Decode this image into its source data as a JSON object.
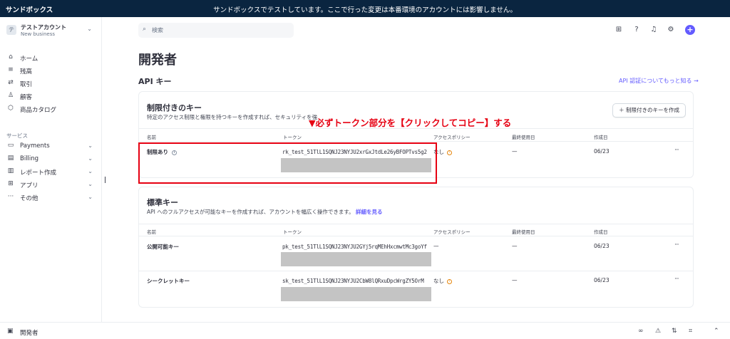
{
  "banner": {
    "brand": "サンドボックス",
    "message": "サンドボックスでテストしています。ここで行った変更は本番環境のアカウントには影響しません。"
  },
  "account": {
    "logo_letter": "テ",
    "name": "テストアカウント",
    "subtitle": "New business"
  },
  "sidebar": {
    "items": [
      {
        "icon": "home-icon",
        "label": "ホーム"
      },
      {
        "icon": "balance-icon",
        "label": "残高"
      },
      {
        "icon": "transactions-icon",
        "label": "取引"
      },
      {
        "icon": "customers-icon",
        "label": "顧客"
      },
      {
        "icon": "product-catalog-icon",
        "label": "商品カタログ"
      }
    ],
    "section_label": "サービス",
    "services": [
      {
        "icon": "payments-icon",
        "label": "Payments"
      },
      {
        "icon": "billing-icon",
        "label": "Billing"
      },
      {
        "icon": "reporting-icon",
        "label": "レポート作成"
      },
      {
        "icon": "apps-icon",
        "label": "アプリ"
      },
      {
        "icon": "more-icon",
        "label": "その他"
      }
    ]
  },
  "search": {
    "placeholder": "検索"
  },
  "page": {
    "title": "開発者",
    "section_title": "API キー",
    "learn_more": "API 認証についてもっと知る →"
  },
  "columns": {
    "name": "名前",
    "token": "トークン",
    "access_policy": "アクセスポリシー",
    "last_used": "最終使用日",
    "created": "作成日"
  },
  "restricted": {
    "title": "制限付きのキー",
    "description": "特定のアクセス制限と権限を持つキーを作成すれば、セキュリティを強",
    "create_button": "＋ 制限付きのキーを作成",
    "row": {
      "name": "制限あり",
      "token": "rk_test_51TlL1SQNJ23NYJU2xrGxJtdLe26yBFOPTvs5g2",
      "policy": "なし",
      "last_used": "—",
      "created": "06/23"
    }
  },
  "standard": {
    "title": "標準キー",
    "description": "API へのフルアクセスが可能なキーを作成すれば、アカウントを幅広く操作できます。",
    "details_link": "詳細を見る",
    "rows": [
      {
        "name": "公開可能キー",
        "token": "pk_test_51TlL1SQNJ23NYJU2GYj5rqMEhHxcmwtMc3goYf",
        "policy": "—",
        "last_used": "—",
        "created": "06/23"
      },
      {
        "name": "シークレットキー",
        "token": "sk_test_51TlL1SQNJ23NYJU2CbW8lQRxuDpcWrgZY5OrM",
        "policy": "なし",
        "last_used": "—",
        "created": "06/23"
      }
    ]
  },
  "annotation": "▼必ずトークン部分を【クリックしてコピー】する",
  "bottom": {
    "label": "開発者"
  },
  "colors": {
    "banner": "#0a2540",
    "accent": "#635bff",
    "annotation_red": "#e60012",
    "mask_gray": "#c4c4c4"
  }
}
